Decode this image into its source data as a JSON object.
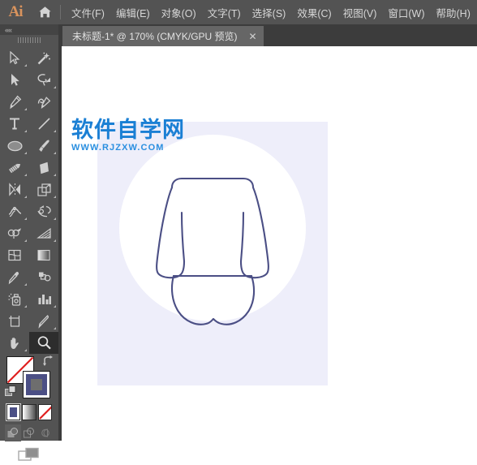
{
  "app": {
    "name": "Ai",
    "logo_label": "Ai",
    "home_icon": "home-icon"
  },
  "menubar": {
    "items": [
      {
        "label": "文件(F)",
        "name": "menu-file"
      },
      {
        "label": "编辑(E)",
        "name": "menu-edit"
      },
      {
        "label": "对象(O)",
        "name": "menu-object"
      },
      {
        "label": "文字(T)",
        "name": "menu-type"
      },
      {
        "label": "选择(S)",
        "name": "menu-select"
      },
      {
        "label": "效果(C)",
        "name": "menu-effect"
      },
      {
        "label": "视图(V)",
        "name": "menu-view"
      },
      {
        "label": "窗口(W)",
        "name": "menu-window"
      },
      {
        "label": "帮助(H)",
        "name": "menu-help"
      }
    ],
    "background": "#535353",
    "text_color": "#d6d6d6"
  },
  "tabbar": {
    "tab_title": "未标题-1* @ 170% (CMYK/GPU 预览)",
    "close_label": "✕",
    "zoom_level": "170%",
    "color_mode": "CMYK",
    "preview_mode": "GPU 预览",
    "document_name": "未标题-1",
    "modified": true
  },
  "toolbar": {
    "collapse_label": "««",
    "tools": [
      {
        "name": "selection-tool-icon",
        "row": 0,
        "col": 0,
        "has_flyout": true,
        "selected": false
      },
      {
        "name": "magic-wand-tool-icon",
        "row": 0,
        "col": 1,
        "has_flyout": false,
        "selected": false
      },
      {
        "name": "direct-selection-tool-icon",
        "row": 1,
        "col": 0,
        "has_flyout": false,
        "selected": false
      },
      {
        "name": "lasso-tool-icon",
        "row": 1,
        "col": 1,
        "has_flyout": true,
        "selected": false
      },
      {
        "name": "pen-tool-icon",
        "row": 2,
        "col": 0,
        "has_flyout": true,
        "selected": false
      },
      {
        "name": "curvature-tool-icon",
        "row": 2,
        "col": 1,
        "has_flyout": false,
        "selected": false
      },
      {
        "name": "type-tool-icon",
        "row": 3,
        "col": 0,
        "has_flyout": true,
        "selected": false
      },
      {
        "name": "line-segment-tool-icon",
        "row": 3,
        "col": 1,
        "has_flyout": true,
        "selected": false
      },
      {
        "name": "ellipse-tool-icon",
        "row": 4,
        "col": 0,
        "has_flyout": true,
        "selected": false
      },
      {
        "name": "paintbrush-tool-icon",
        "row": 4,
        "col": 1,
        "has_flyout": true,
        "selected": false
      },
      {
        "name": "shaper-tool-icon",
        "row": 5,
        "col": 0,
        "has_flyout": true,
        "selected": false
      },
      {
        "name": "eraser-tool-icon",
        "row": 5,
        "col": 1,
        "has_flyout": true,
        "selected": false
      },
      {
        "name": "rotate-tool-icon",
        "row": 6,
        "col": 0,
        "has_flyout": true,
        "selected": false
      },
      {
        "name": "scale-tool-icon",
        "row": 6,
        "col": 1,
        "has_flyout": true,
        "selected": false
      },
      {
        "name": "width-tool-icon",
        "row": 7,
        "col": 0,
        "has_flyout": true,
        "selected": false
      },
      {
        "name": "free-transform-tool-icon",
        "row": 7,
        "col": 1,
        "has_flyout": true,
        "selected": false
      },
      {
        "name": "shape-builder-tool-icon",
        "row": 8,
        "col": 0,
        "has_flyout": true,
        "selected": false
      },
      {
        "name": "perspective-grid-tool-icon",
        "row": 8,
        "col": 1,
        "has_flyout": true,
        "selected": false
      },
      {
        "name": "mesh-tool-icon",
        "row": 9,
        "col": 0,
        "has_flyout": false,
        "selected": false
      },
      {
        "name": "gradient-tool-icon",
        "row": 9,
        "col": 1,
        "has_flyout": false,
        "selected": false
      },
      {
        "name": "eyedropper-tool-icon",
        "row": 10,
        "col": 0,
        "has_flyout": true,
        "selected": false
      },
      {
        "name": "blend-tool-icon",
        "row": 10,
        "col": 1,
        "has_flyout": false,
        "selected": false
      },
      {
        "name": "symbol-sprayer-tool-icon",
        "row": 11,
        "col": 0,
        "has_flyout": true,
        "selected": false
      },
      {
        "name": "column-graph-tool-icon",
        "row": 11,
        "col": 1,
        "has_flyout": true,
        "selected": false
      },
      {
        "name": "artboard-tool-icon",
        "row": 12,
        "col": 0,
        "has_flyout": false,
        "selected": false
      },
      {
        "name": "slice-tool-icon",
        "row": 12,
        "col": 1,
        "has_flyout": true,
        "selected": false
      },
      {
        "name": "hand-tool-icon",
        "row": 13,
        "col": 0,
        "has_flyout": true,
        "selected": false
      },
      {
        "name": "zoom-tool-icon",
        "row": 13,
        "col": 1,
        "has_flyout": false,
        "selected": true
      }
    ],
    "color": {
      "fill_name": "fill-swatch",
      "fill_color": "#ffffff",
      "fill_is_none": true,
      "stroke_name": "stroke-swatch",
      "stroke_color": "#4b4f85",
      "swap_icon": "swap-fill-stroke-icon",
      "default_icon": "default-fill-stroke-icon"
    },
    "mode_buttons": [
      {
        "name": "color-mode-button",
        "label": "color",
        "selected": true
      },
      {
        "name": "gradient-mode-button",
        "label": "gradient",
        "selected": false
      },
      {
        "name": "none-mode-button",
        "label": "none",
        "selected": false
      }
    ],
    "draw_buttons": [
      {
        "name": "draw-normal-button",
        "selected": true
      },
      {
        "name": "draw-behind-button",
        "selected": false
      },
      {
        "name": "draw-inside-button",
        "selected": false
      }
    ],
    "screen_mode": {
      "name": "change-screen-mode-button"
    }
  },
  "canvas": {
    "artboard_background": "#eeeefa",
    "circle_color": "#ffffff",
    "stroke_color": "#4b4f85",
    "document_background": "#ffffff",
    "artwork_name": "sweater-blouse-illustration"
  },
  "watermark": {
    "chinese": "软件自学网",
    "url": "WWW.RJZXW.COM",
    "color": "#1a7fd4"
  }
}
